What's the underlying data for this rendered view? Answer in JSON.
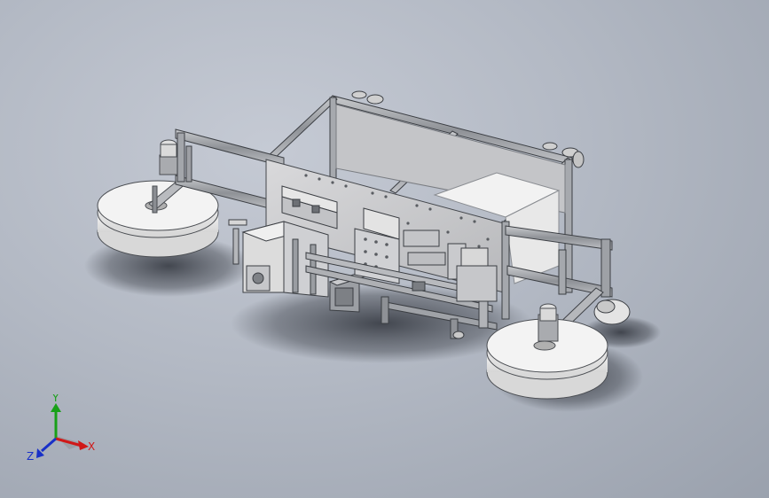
{
  "viewport": {
    "background_top": "#c5cad4",
    "background_bottom": "#9aa1ad"
  },
  "model": {
    "icon": "machine-assembly",
    "part_color": "#d4d4d4",
    "frame_color": "#9da0a6",
    "dark_color": "#55585e",
    "shadow_color": "#3c4048"
  },
  "triad": {
    "x_label": "X",
    "y_label": "Y",
    "z_label": "Z",
    "x_color": "#d01818",
    "y_color": "#18a018",
    "z_color": "#1830c8"
  }
}
